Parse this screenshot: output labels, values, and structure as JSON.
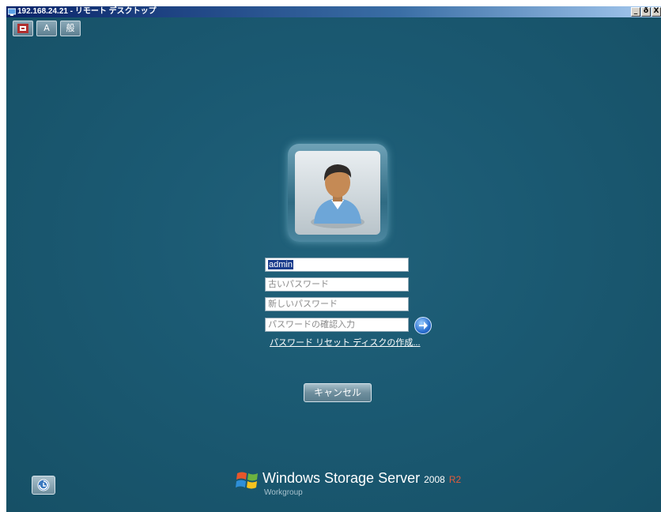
{
  "window": {
    "title": "192.168.24.21 - リモート デスクトップ",
    "buttons": [
      "_",
      "ð",
      "X"
    ]
  },
  "language_bar": {
    "ime_mode_label": "A",
    "kana_mode_label": "般"
  },
  "login": {
    "username_value": "admin",
    "old_password_placeholder": "古いパスワード",
    "new_password_placeholder": "新しいパスワード",
    "confirm_password_placeholder": "パスワードの確認入力",
    "reset_disk_link": "パスワード リセット ディスクの作成...",
    "cancel_label": "キャンセル"
  },
  "brand": {
    "product": "Windows Storage Server",
    "version": "2008",
    "release": "R2",
    "edition": "Workgroup"
  },
  "colors": {
    "background": "#1c5870",
    "title_bar": "#0a246a",
    "selection": "#1a3c8c",
    "r2_accent": "#e35b3c"
  }
}
